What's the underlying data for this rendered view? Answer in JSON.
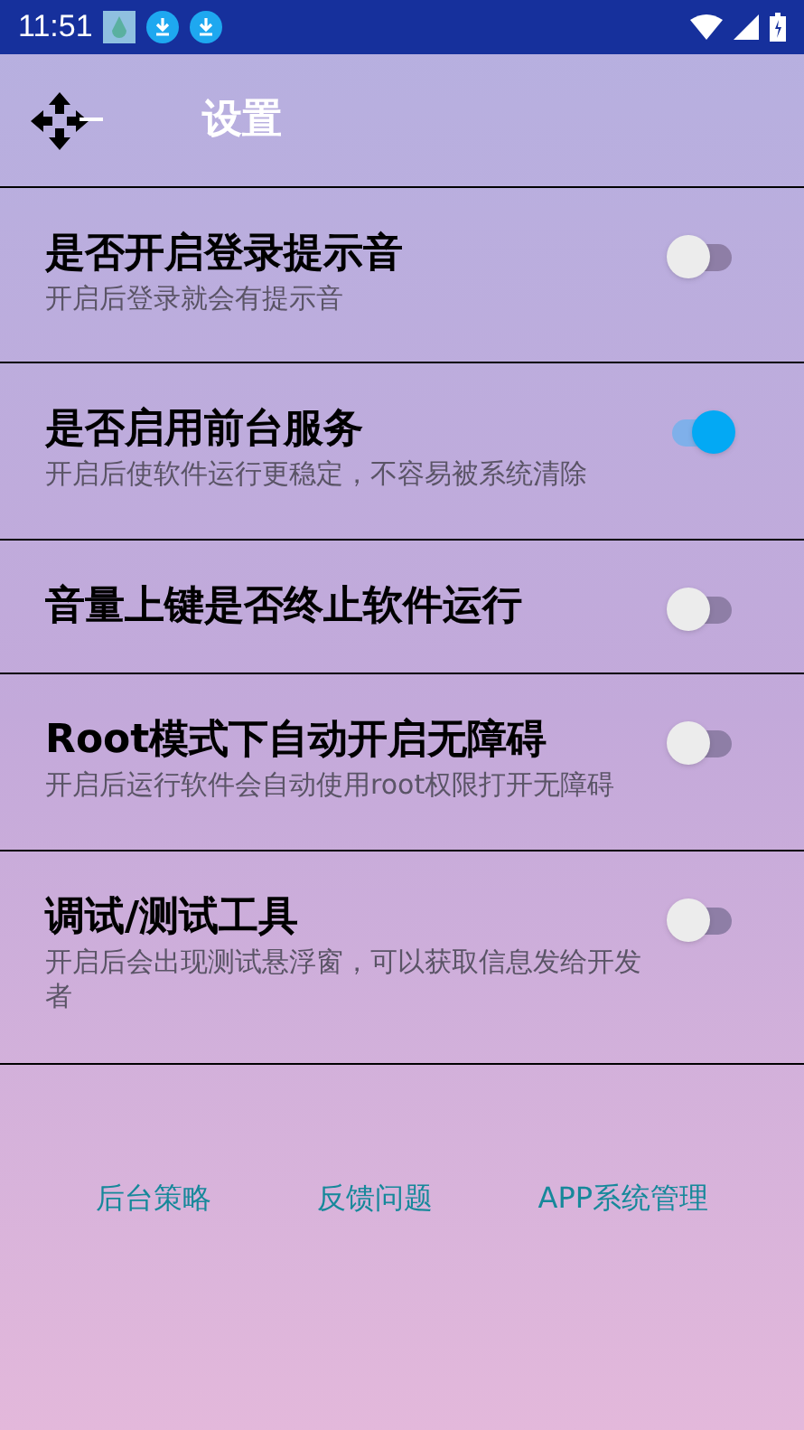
{
  "status_bar": {
    "time": "11:51"
  },
  "header": {
    "title": "设置"
  },
  "settings": [
    {
      "title": "是否开启登录提示音",
      "subtitle": "开启后登录就会有提示音",
      "on": false
    },
    {
      "title": "是否启用前台服务",
      "subtitle": "开启后使软件运行更稳定，不容易被系统清除",
      "on": true
    },
    {
      "title": "音量上键是否终止软件运行",
      "on": false
    },
    {
      "title": "Root模式下自动开启无障碍",
      "subtitle": "开启后运行软件会自动使用root权限打开无障碍",
      "on": false
    },
    {
      "title": "调试/测试工具",
      "subtitle": "开启后会出现测试悬浮窗，可以获取信息发给开发者",
      "on": false
    }
  ],
  "links": [
    "后台策略",
    "反馈问题",
    "APP系统管理"
  ]
}
